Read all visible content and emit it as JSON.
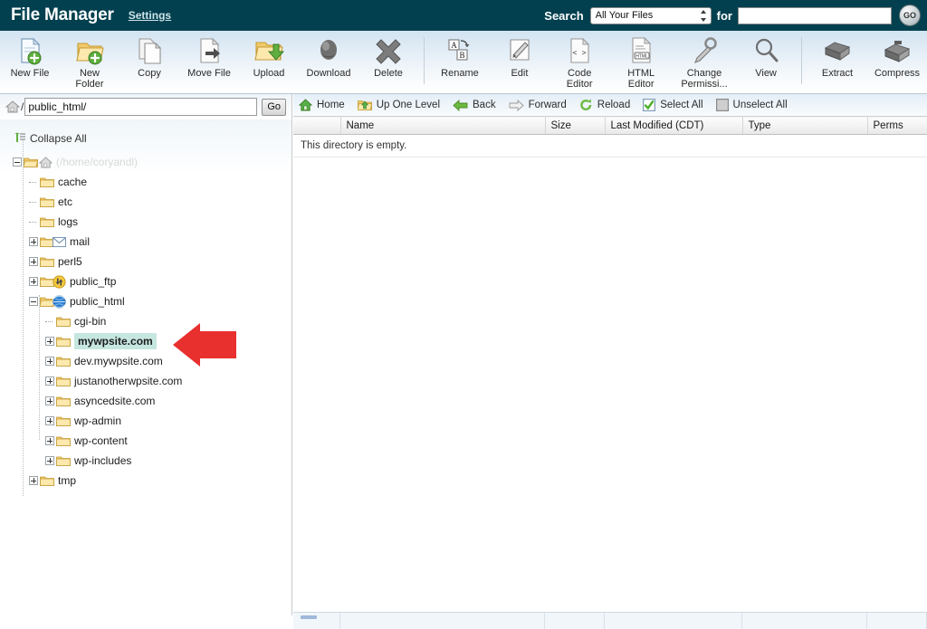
{
  "header": {
    "title": "File Manager",
    "settings_label": "Settings",
    "search_label": "Search",
    "search_for_label": "for",
    "search_scope_selected": "All Your Files",
    "search_scope_options": [
      "All Your Files"
    ],
    "search_value": "",
    "search_placeholder": "",
    "go_button_label": "GO",
    "bar_color": "#02404f"
  },
  "toolbar": {
    "items": [
      {
        "label": "New File",
        "icon": "new-file-icon"
      },
      {
        "label": "New Folder",
        "icon": "new-folder-icon"
      },
      {
        "label": "Copy",
        "icon": "copy-icon"
      },
      {
        "label": "Move File",
        "icon": "move-file-icon"
      },
      {
        "label": "Upload",
        "icon": "upload-icon"
      },
      {
        "label": "Download",
        "icon": "download-icon"
      },
      {
        "label": "Delete",
        "icon": "delete-icon"
      },
      {
        "label": "Rename",
        "icon": "rename-icon"
      },
      {
        "label": "Edit",
        "icon": "edit-icon"
      },
      {
        "label": "Code Editor",
        "icon": "code-editor-icon"
      },
      {
        "label": "HTML Editor",
        "icon": "html-editor-icon"
      },
      {
        "label": "Change Permissi...",
        "icon": "change-permissions-icon"
      },
      {
        "label": "View",
        "icon": "view-icon"
      },
      {
        "label": "Extract",
        "icon": "extract-icon"
      },
      {
        "label": "Compress",
        "icon": "compress-icon"
      }
    ]
  },
  "pathbar": {
    "home_icon": "home-icon",
    "separator": "/",
    "value": "public_html/",
    "go_label": "Go"
  },
  "tree": {
    "collapse_all_label": "Collapse All",
    "root": {
      "label": "(/home/coryandl)",
      "icon": "home-icon"
    },
    "nodes": [
      {
        "label": "cache",
        "depth": 1,
        "expander": "none",
        "badge": ""
      },
      {
        "label": "etc",
        "depth": 1,
        "expander": "none",
        "badge": ""
      },
      {
        "label": "logs",
        "depth": 1,
        "expander": "none",
        "badge": ""
      },
      {
        "label": "mail",
        "depth": 1,
        "expander": "plus",
        "badge": "mail-icon"
      },
      {
        "label": "perl5",
        "depth": 1,
        "expander": "plus",
        "badge": ""
      },
      {
        "label": "public_ftp",
        "depth": 1,
        "expander": "plus",
        "badge": "ftp-icon"
      },
      {
        "label": "public_html",
        "depth": 1,
        "expander": "minus",
        "badge": "globe-icon"
      },
      {
        "label": "cgi-bin",
        "depth": 2,
        "expander": "none",
        "badge": ""
      },
      {
        "label": "mywpsite.com",
        "depth": 2,
        "expander": "plus",
        "badge": "",
        "selected": true
      },
      {
        "label": "dev.mywpsite.com",
        "depth": 2,
        "expander": "plus",
        "badge": ""
      },
      {
        "label": "justanotherwpsite.com",
        "depth": 2,
        "expander": "plus",
        "badge": ""
      },
      {
        "label": "asyncedsite.com",
        "depth": 2,
        "expander": "plus",
        "badge": ""
      },
      {
        "label": "wp-admin",
        "depth": 2,
        "expander": "plus",
        "badge": ""
      },
      {
        "label": "wp-content",
        "depth": 2,
        "expander": "plus",
        "badge": ""
      },
      {
        "label": "wp-includes",
        "depth": 2,
        "expander": "plus",
        "badge": ""
      },
      {
        "label": "tmp",
        "depth": 1,
        "expander": "plus",
        "badge": ""
      }
    ],
    "selected_highlight_color": "#c6e6e0"
  },
  "filepanel": {
    "nav": [
      {
        "label": "Home",
        "icon": "home-icon"
      },
      {
        "label": "Up One Level",
        "icon": "up-one-level-icon"
      },
      {
        "label": "Back",
        "icon": "back-arrow-icon"
      },
      {
        "label": "Forward",
        "icon": "forward-arrow-icon"
      },
      {
        "label": "Reload",
        "icon": "reload-icon"
      },
      {
        "label": "Select All",
        "icon": "checkbox-checked-icon"
      },
      {
        "label": "Unselect All",
        "icon": "checkbox-empty-icon"
      }
    ],
    "columns": [
      "",
      "Name",
      "Size",
      "Last Modified (CDT)",
      "Type",
      "Perms"
    ],
    "rows": [],
    "empty_message": "This directory is empty."
  },
  "annotation": {
    "arrow_color": "#e8302f",
    "points_to": "mywpsite.com"
  }
}
